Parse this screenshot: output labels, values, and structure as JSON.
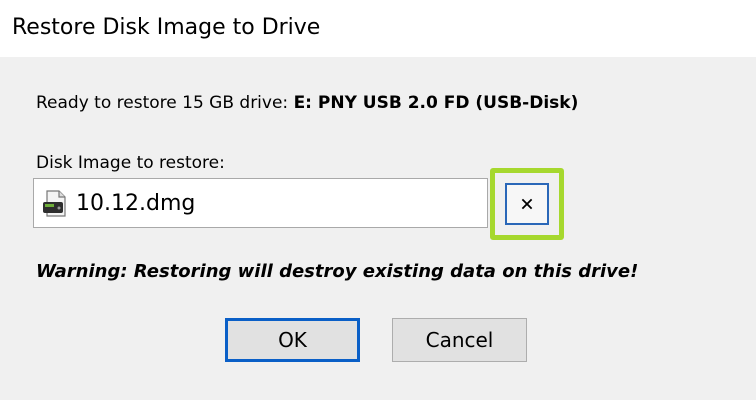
{
  "window": {
    "title": "Restore Disk Image to Drive"
  },
  "ready": {
    "prefix": "Ready to restore 15 GB drive:",
    "drive": "E: PNY USB 2.0 FD (USB-Disk)"
  },
  "image_field": {
    "label": "Disk Image to restore:",
    "value": "10.12.dmg",
    "icon": "disk-image-file-icon",
    "clear_icon": "close-icon"
  },
  "warning": "Warning: Restoring will destroy existing data on this drive!",
  "buttons": {
    "ok_label": "OK",
    "cancel_label": "Cancel"
  },
  "colors": {
    "highlight": "#a6d82e",
    "focus_border": "#0a5fc7"
  }
}
